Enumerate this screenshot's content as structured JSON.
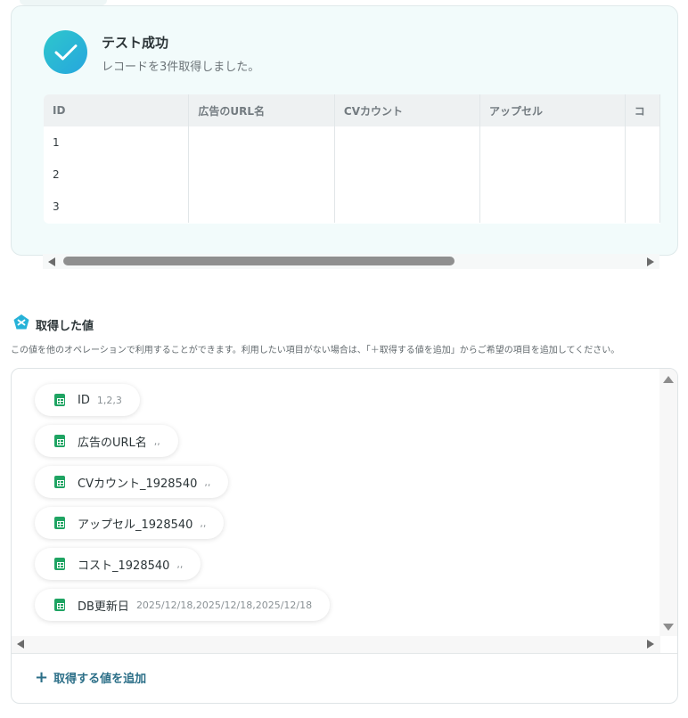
{
  "success": {
    "title": "テスト成功",
    "subtitle": "レコードを3件取得しました。"
  },
  "table": {
    "columns": [
      "ID",
      "広告のURL名",
      "CVカウント",
      "アップセル",
      "コ"
    ],
    "rows": [
      [
        "1",
        "",
        "",
        "",
        ""
      ],
      [
        "2",
        "",
        "",
        "",
        ""
      ],
      [
        "3",
        "",
        "",
        "",
        ""
      ]
    ]
  },
  "section": {
    "title": "取得した値",
    "description": "この値を他のオペレーションで利用することができます。利用したい項目がない場合は、「＋取得する値を追加」からご希望の項目を追加してください。"
  },
  "values": [
    {
      "label": "ID",
      "value": "1,2,3"
    },
    {
      "label": "広告のURL名",
      "value": ",,"
    },
    {
      "label": "CVカウント_1928540",
      "value": ",,"
    },
    {
      "label": "アップセル_1928540",
      "value": ",,"
    },
    {
      "label": "コスト_1928540",
      "value": ",,"
    },
    {
      "label": "DB更新日",
      "value": "2025/12/18,2025/12/18,2025/12/18"
    }
  ],
  "add_button": {
    "label": "取得する値を追加"
  },
  "colors": {
    "accent": "#2c6f88",
    "success_gradient_start": "#2ec7cc",
    "success_gradient_end": "#26a6de",
    "sheet_green": "#1fa463"
  }
}
